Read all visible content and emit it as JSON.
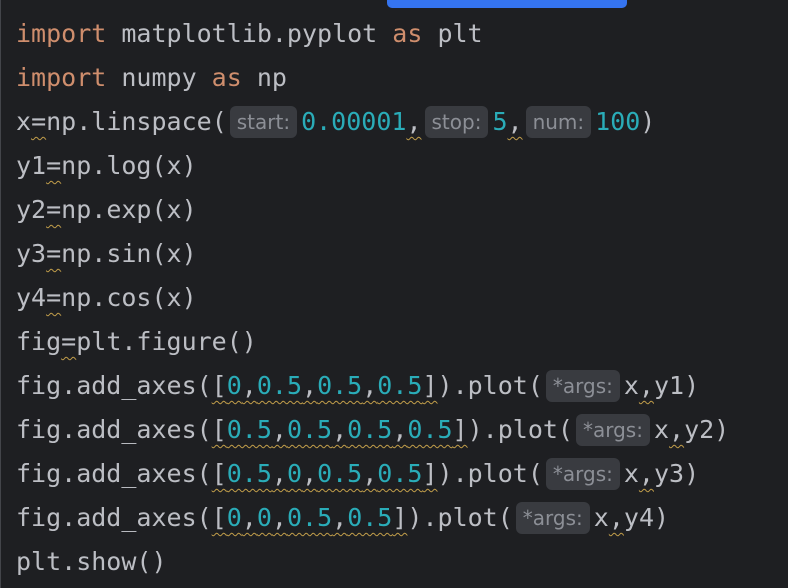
{
  "editor": {
    "lines": [
      [
        {
          "t": "import",
          "c": "kw"
        },
        {
          "t": " matplotlib.pyplot ",
          "c": "plain"
        },
        {
          "t": "as",
          "c": "kw"
        },
        {
          "t": " plt",
          "c": "plain"
        }
      ],
      [
        {
          "t": "import",
          "c": "kw"
        },
        {
          "t": " numpy ",
          "c": "plain"
        },
        {
          "t": "as",
          "c": "kw"
        },
        {
          "t": " np",
          "c": "plain"
        }
      ],
      [
        {
          "t": "x",
          "c": "plain"
        },
        {
          "t": "=",
          "c": "plain",
          "sq": true
        },
        {
          "t": "np.linspace(",
          "c": "plain"
        },
        {
          "h": "start:"
        },
        {
          "t": "0.00001",
          "c": "num"
        },
        {
          "t": ",",
          "c": "plain",
          "sq": true
        },
        {
          "h": "stop:"
        },
        {
          "t": "5",
          "c": "num"
        },
        {
          "t": ",",
          "c": "plain",
          "sq": true
        },
        {
          "h": "num:"
        },
        {
          "t": "100",
          "c": "num"
        },
        {
          "t": ")",
          "c": "plain"
        }
      ],
      [
        {
          "t": "y1",
          "c": "plain"
        },
        {
          "t": "=",
          "c": "plain",
          "sq": true
        },
        {
          "t": "np.log(x)",
          "c": "plain"
        }
      ],
      [
        {
          "t": "y2",
          "c": "plain"
        },
        {
          "t": "=",
          "c": "plain",
          "sq": true
        },
        {
          "t": "np.exp(x)",
          "c": "plain"
        }
      ],
      [
        {
          "t": "y3",
          "c": "plain"
        },
        {
          "t": "=",
          "c": "plain",
          "sq": true
        },
        {
          "t": "np.sin(x)",
          "c": "plain"
        }
      ],
      [
        {
          "t": "y4",
          "c": "plain"
        },
        {
          "t": "=",
          "c": "plain",
          "sq": true
        },
        {
          "t": "np.cos(x)",
          "c": "plain"
        }
      ],
      [
        {
          "t": "fig",
          "c": "plain"
        },
        {
          "t": "=",
          "c": "plain",
          "sq": true
        },
        {
          "t": "plt.figure()",
          "c": "plain"
        }
      ],
      [
        {
          "t": "fig.add_axes(",
          "c": "plain"
        },
        {
          "t": "[",
          "c": "plain",
          "sq": true
        },
        {
          "t": "0",
          "c": "num",
          "sq": true
        },
        {
          "t": ",",
          "c": "plain",
          "sq": true
        },
        {
          "t": "0.5",
          "c": "num",
          "sq": true
        },
        {
          "t": ",",
          "c": "plain",
          "sq": true
        },
        {
          "t": "0.5",
          "c": "num",
          "sq": true
        },
        {
          "t": ",",
          "c": "plain",
          "sq": true
        },
        {
          "t": "0.5",
          "c": "num",
          "sq": true
        },
        {
          "t": "]",
          "c": "plain",
          "sq": true
        },
        {
          "t": ").plot(",
          "c": "plain"
        },
        {
          "h": "*args:"
        },
        {
          "t": "x",
          "c": "plain"
        },
        {
          "t": ",",
          "c": "plain",
          "sq": true
        },
        {
          "t": "y1)",
          "c": "plain"
        }
      ],
      [
        {
          "t": "fig.add_axes(",
          "c": "plain"
        },
        {
          "t": "[",
          "c": "plain",
          "sq": true
        },
        {
          "t": "0.5",
          "c": "num",
          "sq": true
        },
        {
          "t": ",",
          "c": "plain",
          "sq": true
        },
        {
          "t": "0.5",
          "c": "num",
          "sq": true
        },
        {
          "t": ",",
          "c": "plain",
          "sq": true
        },
        {
          "t": "0.5",
          "c": "num",
          "sq": true
        },
        {
          "t": ",",
          "c": "plain",
          "sq": true
        },
        {
          "t": "0.5",
          "c": "num",
          "sq": true
        },
        {
          "t": "]",
          "c": "plain",
          "sq": true
        },
        {
          "t": ").plot(",
          "c": "plain"
        },
        {
          "h": "*args:"
        },
        {
          "t": "x",
          "c": "plain"
        },
        {
          "t": ",",
          "c": "plain",
          "sq": true
        },
        {
          "t": "y2)",
          "c": "plain"
        }
      ],
      [
        {
          "t": "fig.add_axes(",
          "c": "plain"
        },
        {
          "t": "[",
          "c": "plain",
          "sq": true
        },
        {
          "t": "0.5",
          "c": "num",
          "sq": true
        },
        {
          "t": ",",
          "c": "plain",
          "sq": true
        },
        {
          "t": "0",
          "c": "num",
          "sq": true
        },
        {
          "t": ",",
          "c": "plain",
          "sq": true
        },
        {
          "t": "0.5",
          "c": "num",
          "sq": true
        },
        {
          "t": ",",
          "c": "plain",
          "sq": true
        },
        {
          "t": "0.5",
          "c": "num",
          "sq": true
        },
        {
          "t": "]",
          "c": "plain",
          "sq": true
        },
        {
          "t": ").plot(",
          "c": "plain"
        },
        {
          "h": "*args:"
        },
        {
          "t": "x",
          "c": "plain"
        },
        {
          "t": ",",
          "c": "plain",
          "sq": true
        },
        {
          "t": "y3)",
          "c": "plain"
        }
      ],
      [
        {
          "t": "fig.add_axes(",
          "c": "plain"
        },
        {
          "t": "[",
          "c": "plain",
          "sq": true
        },
        {
          "t": "0",
          "c": "num",
          "sq": true
        },
        {
          "t": ",",
          "c": "plain",
          "sq": true
        },
        {
          "t": "0",
          "c": "num",
          "sq": true
        },
        {
          "t": ",",
          "c": "plain",
          "sq": true
        },
        {
          "t": "0.5",
          "c": "num",
          "sq": true
        },
        {
          "t": ",",
          "c": "plain",
          "sq": true
        },
        {
          "t": "0.5",
          "c": "num",
          "sq": true
        },
        {
          "t": "]",
          "c": "plain",
          "sq": true
        },
        {
          "t": ").plot(",
          "c": "plain"
        },
        {
          "h": "*args:"
        },
        {
          "t": "x",
          "c": "plain"
        },
        {
          "t": ",",
          "c": "plain",
          "sq": true
        },
        {
          "t": "y4)",
          "c": "plain"
        }
      ],
      [
        {
          "t": "plt.show()",
          "c": "plain"
        }
      ]
    ]
  },
  "colors": {
    "background": "#1e1f22",
    "keyword": "#cf8e6d",
    "number": "#2aacb8",
    "text": "#bcbec4",
    "hint_background": "#393b40",
    "hint_text": "#8c8f96",
    "warning_squiggle": "#c29e4a",
    "scrollbar_thumb": "#3574f0"
  }
}
